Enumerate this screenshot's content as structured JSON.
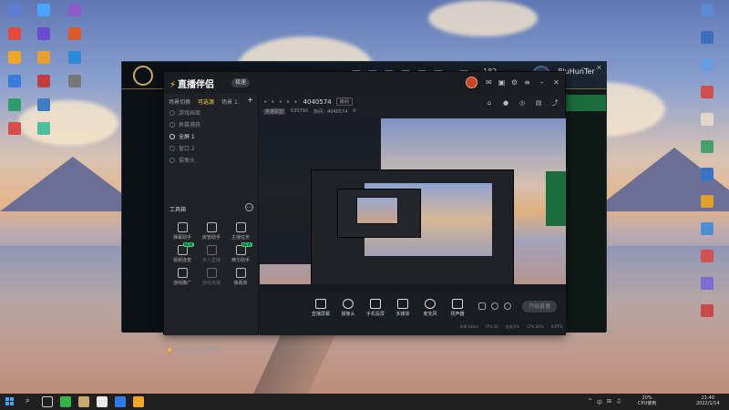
{
  "desktop": {
    "icons_left": [
      {
        "label": "",
        "color": "#5b7bd5"
      },
      {
        "label": "",
        "color": "#e34a3f"
      },
      {
        "label": "",
        "color": "#f2a627"
      },
      {
        "label": "",
        "color": "#3a7be0"
      },
      {
        "label": "",
        "color": "#2f9a6c"
      },
      {
        "label": "",
        "color": "#d94c4c"
      },
      {
        "label": "",
        "color": "#4aa3ff"
      },
      {
        "label": "",
        "color": "#6b4bd1"
      },
      {
        "label": "",
        "color": "#e6a12c"
      },
      {
        "label": "",
        "color": "#c23f3f"
      },
      {
        "label": "",
        "color": "#3f7cc2"
      },
      {
        "label": "",
        "color": "#4ac0a0"
      },
      {
        "label": "",
        "color": "#8a5cc9"
      },
      {
        "label": "",
        "color": "#d95a2b"
      },
      {
        "label": "",
        "color": "#2b8ad9"
      },
      {
        "label": "",
        "color": "#777777"
      }
    ],
    "icons_right": [
      {
        "label": "",
        "color": "#5a8ad6"
      },
      {
        "label": "",
        "color": "#3b6fbe"
      },
      {
        "label": "",
        "color": "#6b9be0"
      },
      {
        "label": "",
        "color": "#d24f4f"
      },
      {
        "label": "",
        "color": "#e0d7c9"
      },
      {
        "label": "",
        "color": "#45a06a"
      },
      {
        "label": "",
        "color": "#3974c4"
      },
      {
        "label": "",
        "color": "#e2a02b"
      },
      {
        "label": "",
        "color": "#4c8fd4"
      },
      {
        "label": "",
        "color": "#d45151"
      },
      {
        "label": "",
        "color": "#7c6bd3"
      },
      {
        "label": "",
        "color": "#c94a4a"
      }
    ]
  },
  "game_client": {
    "rp": "182",
    "username": "BluHunTer"
  },
  "app": {
    "name": "直播伴侣",
    "badge": "极速",
    "scene_tabs": [
      "场景切换",
      "可选源",
      "场景 1"
    ],
    "scene_items": [
      "游戏画面",
      "屏幕捕获",
      "全屏 1",
      "窗口 2",
      "摄像头"
    ],
    "tools_title": "工具箱",
    "tools": [
      {
        "label": "弹幕助手",
        "dim": false,
        "new": false
      },
      {
        "label": "房管助手",
        "dim": false,
        "new": false
      },
      {
        "label": "主播任务",
        "dim": false,
        "new": false
      },
      {
        "label": "视频连麦",
        "dim": false,
        "new": true
      },
      {
        "label": "多人直播",
        "dim": true,
        "new": false
      },
      {
        "label": "精华助手",
        "dim": false,
        "new": true
      },
      {
        "label": "游戏推广",
        "dim": false,
        "new": false
      },
      {
        "label": "游戏点播",
        "dim": true,
        "new": false
      },
      {
        "label": "弹幕库",
        "dim": false,
        "new": false
      }
    ],
    "notice": "斗鱼直播伴侣使用帮助",
    "room": {
      "dots": "• • • • •",
      "id": "4040574",
      "share_label": "房间",
      "category": "英雄联盟",
      "stat_followers": "635793",
      "stat_room": "房间：4040574",
      "stat_hot": "0"
    },
    "controls": [
      "直播屏幕",
      "摄像头",
      "手机投屏",
      "多媒体",
      "麦克风",
      "扬声器"
    ],
    "go_live": "开始直播",
    "status": [
      "码率:0kb/s",
      "FPS:30",
      "丢帧:0%",
      "CPU:20%",
      "60FPS"
    ]
  },
  "taskbar": {
    "tray_items": [
      "^",
      "中",
      "⊞",
      "♫"
    ],
    "cpu_line1": "20%",
    "cpu_line2": "CPU使用",
    "time": "21:40",
    "date": "2022/1/14"
  }
}
